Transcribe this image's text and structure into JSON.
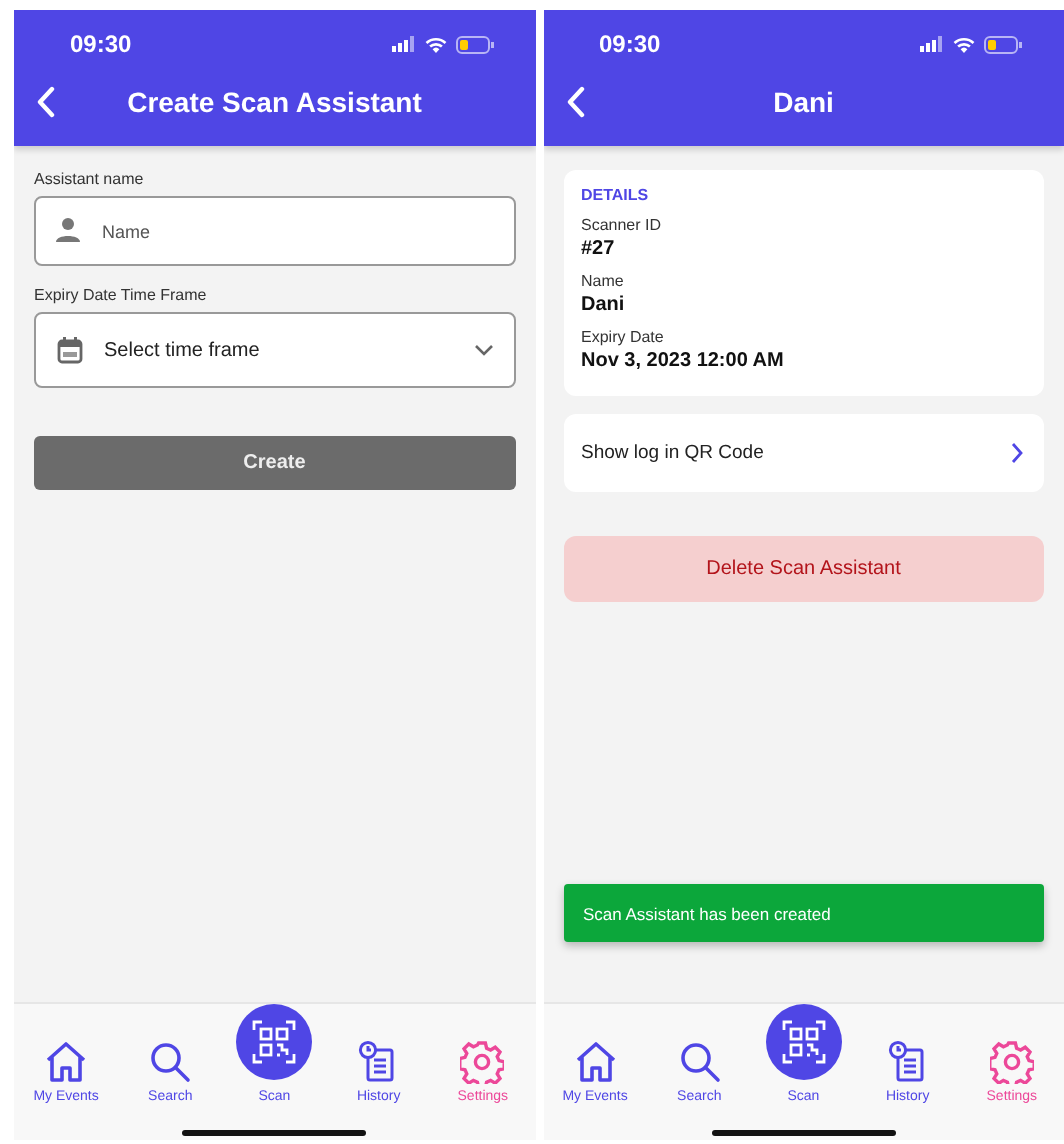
{
  "screens": [
    {
      "kind": "form",
      "status": {
        "time": "09:30"
      },
      "header": {
        "title": "Create Scan Assistant"
      },
      "fields": [
        {
          "kind": "text",
          "label": "Assistant name",
          "placeholder": "Name"
        },
        {
          "kind": "select",
          "label": "Expiry Date Time Frame",
          "value": "Select time frame"
        }
      ],
      "button": {
        "label": "Create",
        "disabled": true
      },
      "nav": [
        {
          "kind": "tab",
          "label": "My Events",
          "selected": false
        },
        {
          "kind": "tab",
          "label": "Search",
          "selected": false
        },
        {
          "kind": "fab",
          "label": "Scan",
          "selected": false
        },
        {
          "kind": "tab",
          "label": "History",
          "selected": false
        },
        {
          "kind": "tab",
          "label": "Settings",
          "selected": true
        }
      ]
    },
    {
      "kind": "detail",
      "status": {
        "time": "09:30"
      },
      "header": {
        "title": "Dani"
      },
      "section_title": "DETAILS",
      "details": [
        {
          "label": "Scanner ID",
          "value": "#27"
        },
        {
          "label": "Name",
          "value": "Dani"
        },
        {
          "label": "Expiry Date",
          "value": "Nov 3, 2023 12:00 AM"
        }
      ],
      "link": "Show log in QR Code",
      "delete_button": "Delete Scan Assistant",
      "toast": "Scan Assistant has been created",
      "nav": [
        {
          "kind": "tab",
          "label": "My Events",
          "selected": false
        },
        {
          "kind": "tab",
          "label": "Search",
          "selected": false
        },
        {
          "kind": "fab",
          "label": "Scan",
          "selected": false
        },
        {
          "kind": "tab",
          "label": "History",
          "selected": false
        },
        {
          "kind": "tab",
          "label": "Settings",
          "selected": true
        }
      ]
    }
  ]
}
